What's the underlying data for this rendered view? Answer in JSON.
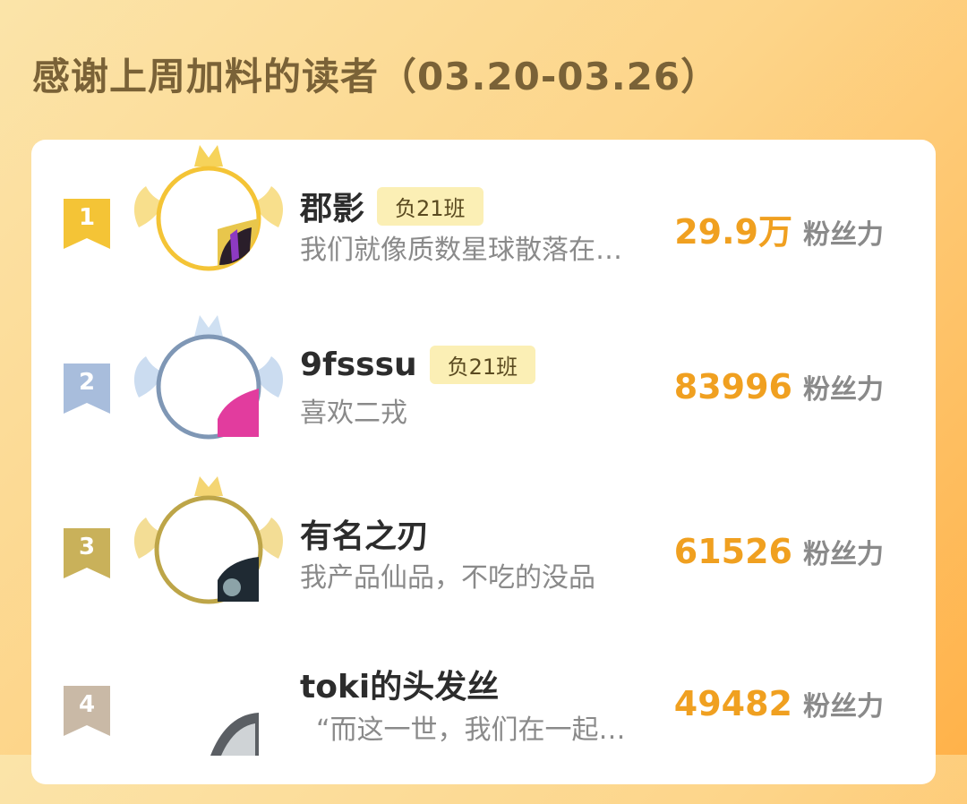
{
  "page": {
    "title": "感谢上周加料的读者（03.20-03.26）"
  },
  "colors": {
    "background_start": "#fbe4a9",
    "background_end": "#ffb24a",
    "fans_value": "#f0a020",
    "gold": "#f4c436",
    "silver": "#7f97b5",
    "bronze": "#bda548",
    "rank4": "#c9b9a6",
    "tag_bg": "#fbefb5"
  },
  "readers": [
    {
      "rank": "1",
      "name": "郡影",
      "tag": "负21班",
      "bio": "我们就像质数星球散落在…",
      "fans_value": "29.9万",
      "fans_label": "粉丝力",
      "frame_icon": "gold-winged-crown-frame-icon"
    },
    {
      "rank": "2",
      "name": "9fsssu",
      "tag": "负21班",
      "bio": "喜欢二戎",
      "fans_value": "83996",
      "fans_label": "粉丝力",
      "frame_icon": "silver-winged-crown-frame-icon"
    },
    {
      "rank": "3",
      "name": "有名之刃",
      "tag": "",
      "bio": "我产品仙品，不吃的没品",
      "fans_value": "61526",
      "fans_label": "粉丝力",
      "frame_icon": "bronze-winged-crown-frame-icon"
    },
    {
      "rank": "4",
      "name": "toki的头发丝",
      "tag": "",
      "bio": "“而这一世，我们在一起…",
      "fans_value": "49482",
      "fans_label": "粉丝力",
      "frame_icon": ""
    }
  ]
}
